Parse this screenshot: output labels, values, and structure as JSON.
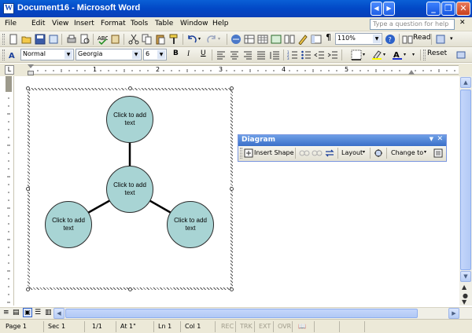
{
  "window": {
    "title": "Document16 - Microsoft Word"
  },
  "menu": {
    "items": [
      "File",
      "Edit",
      "View",
      "Insert",
      "Format",
      "Tools",
      "Table",
      "Window",
      "Help"
    ],
    "question_placeholder": "Type a question for help"
  },
  "standard_toolbar": {
    "zoom": "110%",
    "read_label": "Read"
  },
  "formatting_toolbar": {
    "style": "Normal",
    "font": "Georgia",
    "size": "6",
    "bold": "B",
    "italic": "I",
    "underline": "U",
    "reset_label": "Reset"
  },
  "ruler": {
    "numbers": [
      "1",
      "2",
      "3",
      "4",
      "5"
    ]
  },
  "diagram": {
    "nodes": [
      {
        "text": "Click to add text"
      },
      {
        "text": "Click to add text"
      },
      {
        "text": "Click to add text"
      },
      {
        "text": "Click to add text"
      }
    ],
    "fill_color": "#a8d4d4"
  },
  "diagram_toolbar": {
    "title": "Diagram",
    "insert_shape": "Insert Shape",
    "layout": "Layout",
    "change_to": "Change to"
  },
  "statusbar": {
    "page": "Page 1",
    "sec": "Sec 1",
    "pages": "1/1",
    "at": "At 1\"",
    "ln": "Ln 1",
    "col": "Col 1",
    "rec": "REC",
    "trk": "TRK",
    "ext": "EXT",
    "ovr": "OVR"
  }
}
